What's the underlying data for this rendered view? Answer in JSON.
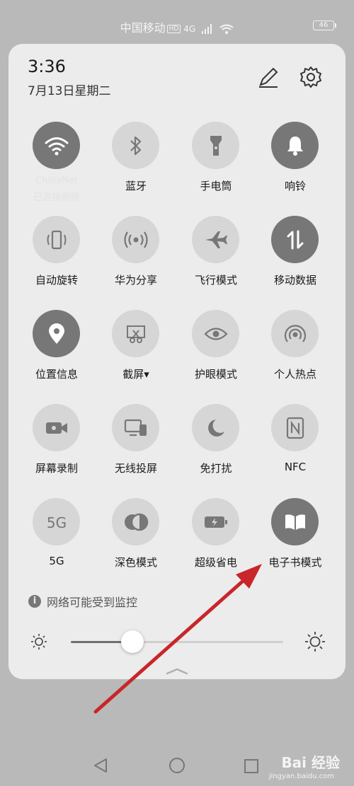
{
  "status_bar": {
    "carrier": "中国移动",
    "hd": "HD",
    "network": "4G",
    "battery": "46"
  },
  "panel": {
    "time": "3:36",
    "date": "7月13日星期二",
    "tiles": [
      {
        "label": "",
        "icon": "wifi-icon",
        "on": true,
        "sub": "ChinaNet",
        "sub2": "已连接网络"
      },
      {
        "label": "蓝牙",
        "icon": "bluetooth-icon",
        "on": false
      },
      {
        "label": "手电筒",
        "icon": "flashlight-icon",
        "on": false
      },
      {
        "label": "响铃",
        "icon": "bell-icon",
        "on": true
      },
      {
        "label": "自动旋转",
        "icon": "rotate-icon",
        "on": false
      },
      {
        "label": "华为分享",
        "icon": "share-icon",
        "on": false
      },
      {
        "label": "飞行模式",
        "icon": "airplane-icon",
        "on": false
      },
      {
        "label": "移动数据",
        "icon": "mobile-data-icon",
        "on": true
      },
      {
        "label": "位置信息",
        "icon": "location-icon",
        "on": true
      },
      {
        "label": "截屏▾",
        "icon": "screenshot-icon",
        "on": false
      },
      {
        "label": "护眼模式",
        "icon": "eye-icon",
        "on": false
      },
      {
        "label": "个人热点",
        "icon": "hotspot-icon",
        "on": false
      },
      {
        "label": "屏幕录制",
        "icon": "record-icon",
        "on": false
      },
      {
        "label": "无线投屏",
        "icon": "cast-icon",
        "on": false
      },
      {
        "label": "免打扰",
        "icon": "moon-icon",
        "on": false
      },
      {
        "label": "NFC",
        "icon": "nfc-icon",
        "on": false
      },
      {
        "label": "5G",
        "icon": "5g-icon",
        "on": false
      },
      {
        "label": "深色模式",
        "icon": "dark-mode-icon",
        "on": false
      },
      {
        "label": "超级省电",
        "icon": "battery-saver-icon",
        "on": false
      },
      {
        "label": "电子书模式",
        "icon": "ebook-icon",
        "on": true
      }
    ],
    "notice": "网络可能受到监控",
    "brightness": 0.29
  },
  "watermark": {
    "text": "Bai 经验",
    "sub": "jingyan.baidu.com"
  },
  "colors": {
    "tile_on": "#777777",
    "tile_off": "#d6d6d6",
    "arrow": "#c8262a"
  }
}
